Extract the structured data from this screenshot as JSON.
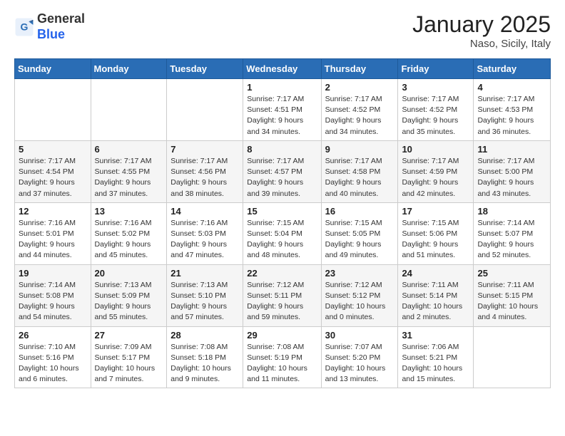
{
  "header": {
    "logo_line1": "General",
    "logo_line2": "Blue",
    "month": "January 2025",
    "location": "Naso, Sicily, Italy"
  },
  "weekdays": [
    "Sunday",
    "Monday",
    "Tuesday",
    "Wednesday",
    "Thursday",
    "Friday",
    "Saturday"
  ],
  "weeks": [
    [
      {
        "day": "",
        "sunrise": "",
        "sunset": "",
        "daylight": ""
      },
      {
        "day": "",
        "sunrise": "",
        "sunset": "",
        "daylight": ""
      },
      {
        "day": "",
        "sunrise": "",
        "sunset": "",
        "daylight": ""
      },
      {
        "day": "1",
        "sunrise": "Sunrise: 7:17 AM",
        "sunset": "Sunset: 4:51 PM",
        "daylight": "Daylight: 9 hours and 34 minutes."
      },
      {
        "day": "2",
        "sunrise": "Sunrise: 7:17 AM",
        "sunset": "Sunset: 4:52 PM",
        "daylight": "Daylight: 9 hours and 34 minutes."
      },
      {
        "day": "3",
        "sunrise": "Sunrise: 7:17 AM",
        "sunset": "Sunset: 4:52 PM",
        "daylight": "Daylight: 9 hours and 35 minutes."
      },
      {
        "day": "4",
        "sunrise": "Sunrise: 7:17 AM",
        "sunset": "Sunset: 4:53 PM",
        "daylight": "Daylight: 9 hours and 36 minutes."
      }
    ],
    [
      {
        "day": "5",
        "sunrise": "Sunrise: 7:17 AM",
        "sunset": "Sunset: 4:54 PM",
        "daylight": "Daylight: 9 hours and 37 minutes."
      },
      {
        "day": "6",
        "sunrise": "Sunrise: 7:17 AM",
        "sunset": "Sunset: 4:55 PM",
        "daylight": "Daylight: 9 hours and 37 minutes."
      },
      {
        "day": "7",
        "sunrise": "Sunrise: 7:17 AM",
        "sunset": "Sunset: 4:56 PM",
        "daylight": "Daylight: 9 hours and 38 minutes."
      },
      {
        "day": "8",
        "sunrise": "Sunrise: 7:17 AM",
        "sunset": "Sunset: 4:57 PM",
        "daylight": "Daylight: 9 hours and 39 minutes."
      },
      {
        "day": "9",
        "sunrise": "Sunrise: 7:17 AM",
        "sunset": "Sunset: 4:58 PM",
        "daylight": "Daylight: 9 hours and 40 minutes."
      },
      {
        "day": "10",
        "sunrise": "Sunrise: 7:17 AM",
        "sunset": "Sunset: 4:59 PM",
        "daylight": "Daylight: 9 hours and 42 minutes."
      },
      {
        "day": "11",
        "sunrise": "Sunrise: 7:17 AM",
        "sunset": "Sunset: 5:00 PM",
        "daylight": "Daylight: 9 hours and 43 minutes."
      }
    ],
    [
      {
        "day": "12",
        "sunrise": "Sunrise: 7:16 AM",
        "sunset": "Sunset: 5:01 PM",
        "daylight": "Daylight: 9 hours and 44 minutes."
      },
      {
        "day": "13",
        "sunrise": "Sunrise: 7:16 AM",
        "sunset": "Sunset: 5:02 PM",
        "daylight": "Daylight: 9 hours and 45 minutes."
      },
      {
        "day": "14",
        "sunrise": "Sunrise: 7:16 AM",
        "sunset": "Sunset: 5:03 PM",
        "daylight": "Daylight: 9 hours and 47 minutes."
      },
      {
        "day": "15",
        "sunrise": "Sunrise: 7:15 AM",
        "sunset": "Sunset: 5:04 PM",
        "daylight": "Daylight: 9 hours and 48 minutes."
      },
      {
        "day": "16",
        "sunrise": "Sunrise: 7:15 AM",
        "sunset": "Sunset: 5:05 PM",
        "daylight": "Daylight: 9 hours and 49 minutes."
      },
      {
        "day": "17",
        "sunrise": "Sunrise: 7:15 AM",
        "sunset": "Sunset: 5:06 PM",
        "daylight": "Daylight: 9 hours and 51 minutes."
      },
      {
        "day": "18",
        "sunrise": "Sunrise: 7:14 AM",
        "sunset": "Sunset: 5:07 PM",
        "daylight": "Daylight: 9 hours and 52 minutes."
      }
    ],
    [
      {
        "day": "19",
        "sunrise": "Sunrise: 7:14 AM",
        "sunset": "Sunset: 5:08 PM",
        "daylight": "Daylight: 9 hours and 54 minutes."
      },
      {
        "day": "20",
        "sunrise": "Sunrise: 7:13 AM",
        "sunset": "Sunset: 5:09 PM",
        "daylight": "Daylight: 9 hours and 55 minutes."
      },
      {
        "day": "21",
        "sunrise": "Sunrise: 7:13 AM",
        "sunset": "Sunset: 5:10 PM",
        "daylight": "Daylight: 9 hours and 57 minutes."
      },
      {
        "day": "22",
        "sunrise": "Sunrise: 7:12 AM",
        "sunset": "Sunset: 5:11 PM",
        "daylight": "Daylight: 9 hours and 59 minutes."
      },
      {
        "day": "23",
        "sunrise": "Sunrise: 7:12 AM",
        "sunset": "Sunset: 5:12 PM",
        "daylight": "Daylight: 10 hours and 0 minutes."
      },
      {
        "day": "24",
        "sunrise": "Sunrise: 7:11 AM",
        "sunset": "Sunset: 5:14 PM",
        "daylight": "Daylight: 10 hours and 2 minutes."
      },
      {
        "day": "25",
        "sunrise": "Sunrise: 7:11 AM",
        "sunset": "Sunset: 5:15 PM",
        "daylight": "Daylight: 10 hours and 4 minutes."
      }
    ],
    [
      {
        "day": "26",
        "sunrise": "Sunrise: 7:10 AM",
        "sunset": "Sunset: 5:16 PM",
        "daylight": "Daylight: 10 hours and 6 minutes."
      },
      {
        "day": "27",
        "sunrise": "Sunrise: 7:09 AM",
        "sunset": "Sunset: 5:17 PM",
        "daylight": "Daylight: 10 hours and 7 minutes."
      },
      {
        "day": "28",
        "sunrise": "Sunrise: 7:08 AM",
        "sunset": "Sunset: 5:18 PM",
        "daylight": "Daylight: 10 hours and 9 minutes."
      },
      {
        "day": "29",
        "sunrise": "Sunrise: 7:08 AM",
        "sunset": "Sunset: 5:19 PM",
        "daylight": "Daylight: 10 hours and 11 minutes."
      },
      {
        "day": "30",
        "sunrise": "Sunrise: 7:07 AM",
        "sunset": "Sunset: 5:20 PM",
        "daylight": "Daylight: 10 hours and 13 minutes."
      },
      {
        "day": "31",
        "sunrise": "Sunrise: 7:06 AM",
        "sunset": "Sunset: 5:21 PM",
        "daylight": "Daylight: 10 hours and 15 minutes."
      },
      {
        "day": "",
        "sunrise": "",
        "sunset": "",
        "daylight": ""
      }
    ]
  ]
}
